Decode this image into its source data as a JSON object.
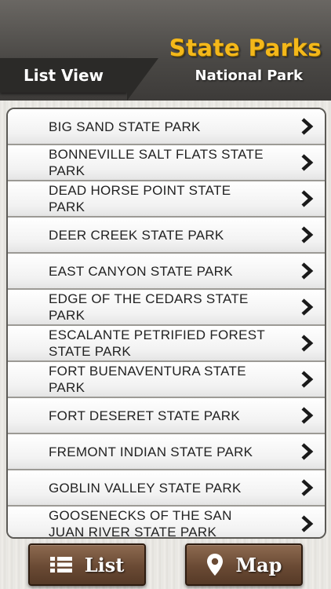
{
  "header": {
    "app_title": "State Parks",
    "app_subtitle": "National Park",
    "view_label": "List View"
  },
  "parks": [
    "BIG SAND STATE PARK",
    "BONNEVILLE SALT FLATS STATE PARK",
    "DEAD HORSE POINT STATE PARK",
    "DEER CREEK STATE PARK",
    "EAST CANYON STATE PARK",
    "EDGE OF THE CEDARS STATE PARK",
    "ESCALANTE PETRIFIED FOREST STATE PARK",
    "FORT BUENAVENTURA STATE PARK",
    "FORT DESERET STATE PARK",
    "FREMONT INDIAN STATE PARK",
    "GOBLIN VALLEY STATE PARK",
    "GOOSENECKS OF THE SAN JUAN RIVER STATE PARK"
  ],
  "bottom_bar": {
    "list_label": "List",
    "map_label": "Map"
  },
  "icons": {
    "row_chevron": "chevron-right-icon",
    "list_button": "list-icon",
    "map_button": "map-pin-icon"
  }
}
